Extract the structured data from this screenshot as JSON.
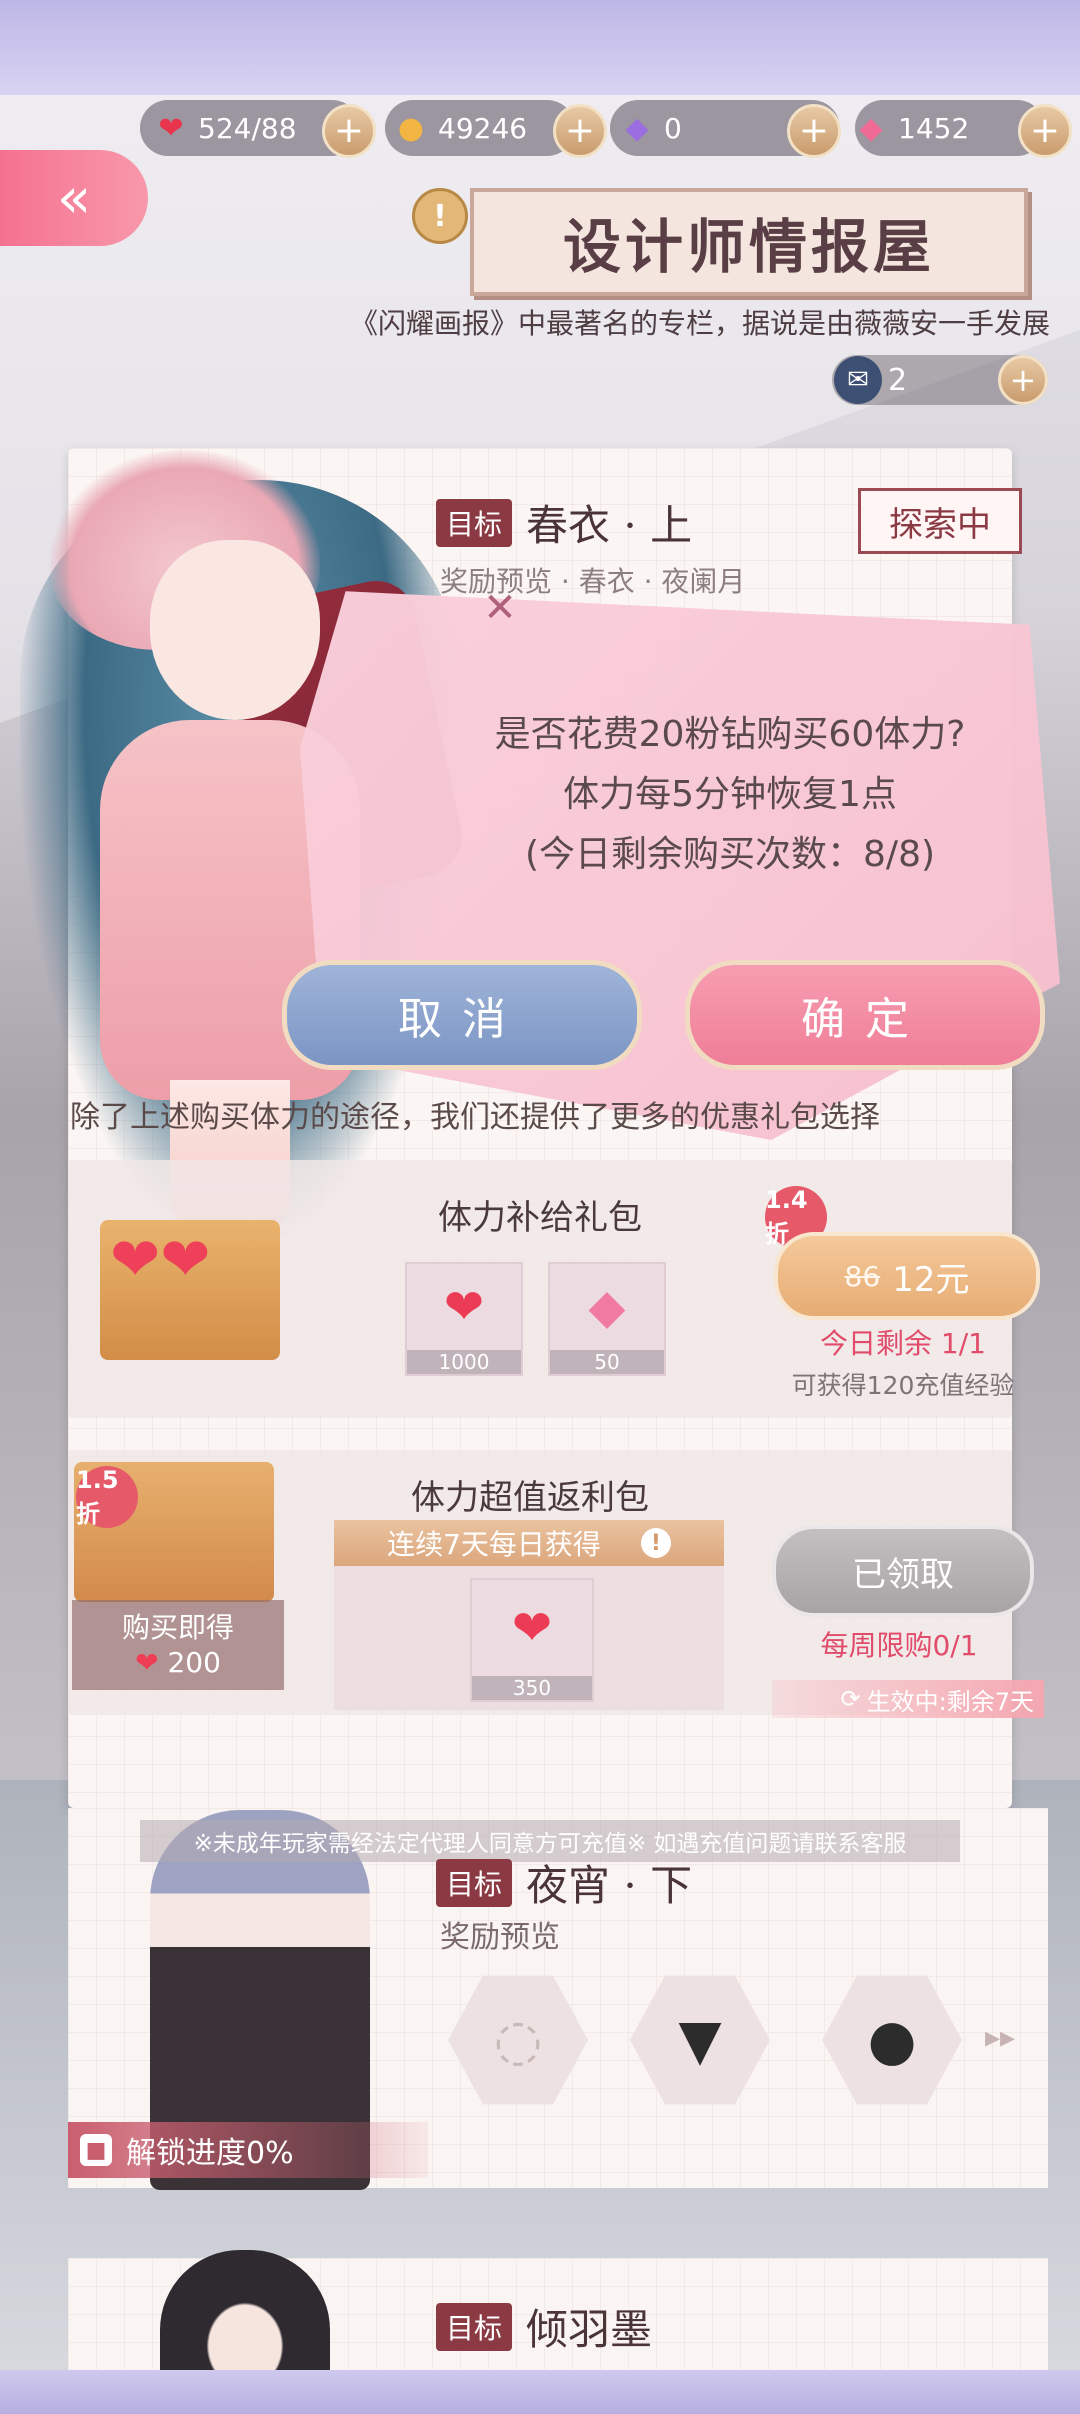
{
  "resources": {
    "stamina": "524/88",
    "gold": "49246",
    "diamond": "0",
    "pink_diamond": "1452",
    "plus": "+"
  },
  "header": {
    "back": "«",
    "title": "设计师情报屋",
    "pin": "!",
    "subtitle": "《闪耀画报》中最著名的专栏，据说是由薇薇安一手发展",
    "ticket_count": "2"
  },
  "card1": {
    "tag": "目标",
    "title": "春衣 · 上",
    "reward_line": "奖励预览 · 春衣 · 夜阑月",
    "status": "探索中"
  },
  "dialog": {
    "line1": "是否花费20粉钻购买60体力?",
    "line2": "体力每5分钟恢复1点",
    "line3": "(今日剩余购买次数：8/8)",
    "cancel": "取消",
    "confirm": "确定"
  },
  "hint": "除了上述购买体力的途径，我们还提供了更多的优惠礼包选择",
  "pack1": {
    "name": "体力补给礼包",
    "discount": "1.4折",
    "items": [
      {
        "icon": "heart-icon",
        "glyph": "❤",
        "count": "1000"
      },
      {
        "icon": "diamond-icon",
        "glyph": "💎",
        "count": "50"
      }
    ],
    "orig_price": "86",
    "price": "12元",
    "remaining": "今日剩余 1/1",
    "exp": "可获得120充值经验"
  },
  "pack2": {
    "name": "体力超值返利包",
    "discount": "1.5折",
    "instant_label": "购买即得",
    "instant_amount": "200",
    "daily_banner": "连续7天每日获得",
    "daily_item_count": "350",
    "claimed": "已领取",
    "weekly_limit": "每周限购0/1",
    "effect": "生效中:剩余7天"
  },
  "notice": "※未成年玩家需经法定代理人同意方可充值※ 如遇充值问题请联系客服",
  "card2": {
    "tag": "目标",
    "title": "夜宵 · 下",
    "reward_label": "奖励预览",
    "lock_progress": "解锁进度0%"
  },
  "card3": {
    "tag": "目标",
    "title": "倾羽墨"
  },
  "colors": {
    "accent_pink": "#ef7e98",
    "accent_blue": "#7b95c4",
    "tag_red": "#8b3a44"
  }
}
